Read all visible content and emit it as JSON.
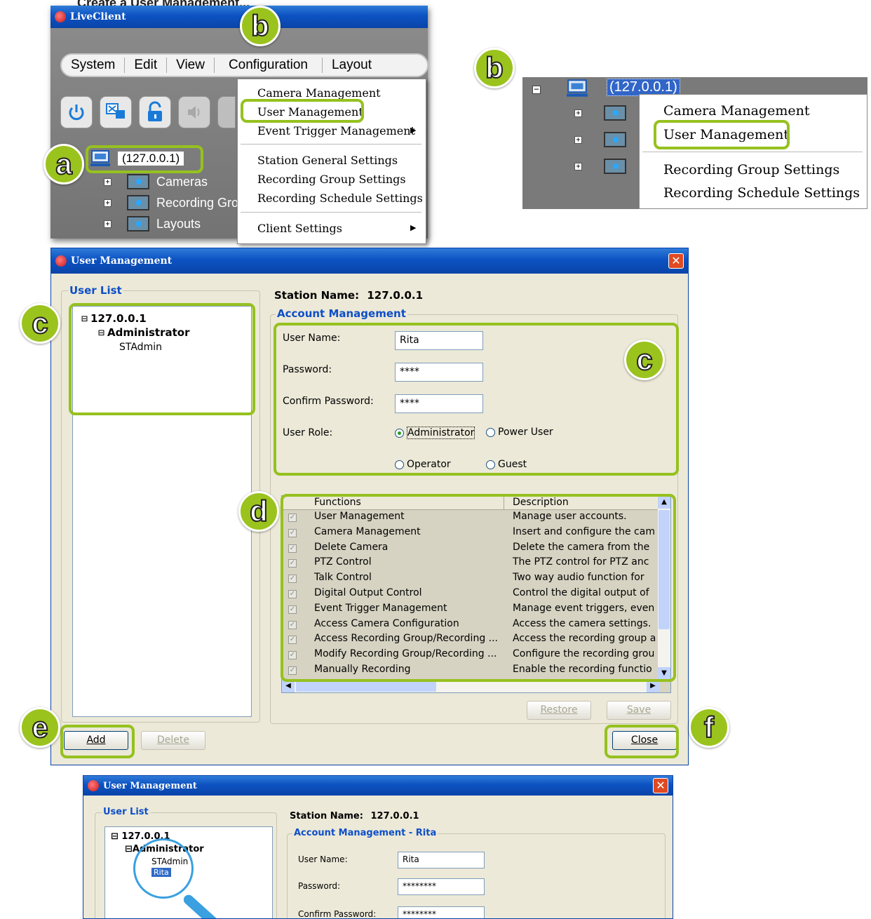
{
  "page_heading": "Create a User Management...",
  "liveclient": {
    "title": "LiveClient",
    "menu": [
      "System",
      "Edit",
      "View",
      "Configuration",
      "Layout"
    ],
    "toolbar_icons": [
      "power-icon",
      "remote-desktop-icon",
      "lock-icon",
      "speaker-icon"
    ],
    "station": "(127.0.0.1)",
    "tree": [
      "Cameras",
      "Recording Gro",
      "Layouts"
    ],
    "context_menu": {
      "items": [
        "Camera Management",
        "User Management",
        "Event Trigger Management",
        "Station General Settings",
        "Recording Group Settings",
        "Recording Schedule Settings",
        "Client Settings"
      ]
    }
  },
  "right_crop": {
    "station": "(127.0.0.1)",
    "items": [
      "Camera Management",
      "User Management",
      "Recording Group Settings",
      "Recording Schedule Settings"
    ]
  },
  "badges": {
    "a": "a",
    "b": "b",
    "c": "c",
    "d": "d",
    "e": "e",
    "f": "f"
  },
  "user_mgmt": {
    "title": "User Management",
    "user_list_label": "User List",
    "tree_root": "127.0.0.1",
    "tree_group": "Administrator",
    "tree_user": "STAdmin",
    "station_name_label": "Station Name:",
    "station_name": "127.0.0.1",
    "account_label": "Account Management",
    "user_name_label": "User Name:",
    "user_name": "Rita",
    "password_label": "Password:",
    "password": "****",
    "confirm_label": "Confirm Password:",
    "confirm": "****",
    "role_label": "User Role:",
    "roles": [
      "Administrator",
      "Power User",
      "Operator",
      "Guest"
    ],
    "selected_role": "Administrator",
    "columns": [
      "Functions",
      "Description"
    ],
    "functions": [
      {
        "name": "User Management",
        "desc": "Manage user accounts."
      },
      {
        "name": "Camera Management",
        "desc": "Insert and configure the cam"
      },
      {
        "name": "Delete Camera",
        "desc": "Delete the camera from the"
      },
      {
        "name": "PTZ Control",
        "desc": "The PTZ control for PTZ anc"
      },
      {
        "name": "Talk Control",
        "desc": "Two way audio function for"
      },
      {
        "name": "Digital Output Control",
        "desc": "Control the digital output of"
      },
      {
        "name": "Event Trigger Management",
        "desc": "Manage event triggers, even"
      },
      {
        "name": "Access Camera Configuration",
        "desc": "Access the camera settings."
      },
      {
        "name": "Access Recording Group/Recording ...",
        "desc": "Access the recording group a"
      },
      {
        "name": "Modify Recording Group/Recording ...",
        "desc": "Configure the recording grou"
      },
      {
        "name": "Manually Recording",
        "desc": "Enable the recording functio"
      }
    ],
    "restore": "Restore",
    "save": "Save",
    "add": "Add",
    "delete": "Delete",
    "close": "Close"
  },
  "user_mgmt2": {
    "title": "User Management",
    "user_list_label": "User List",
    "tree_root": "127.0.0.1",
    "tree_group": "Administrator",
    "tree_user": "STAdmin",
    "tree_user_new": "Rita",
    "station_name_label": "Station Name:",
    "station_name": "127.0.0.1",
    "account_label": "Account Management - Rita",
    "user_name_label": "User Name:",
    "user_name": "Rita",
    "password_label": "Password:",
    "password": "********",
    "confirm_label": "Confirm Password:",
    "confirm": "********"
  }
}
